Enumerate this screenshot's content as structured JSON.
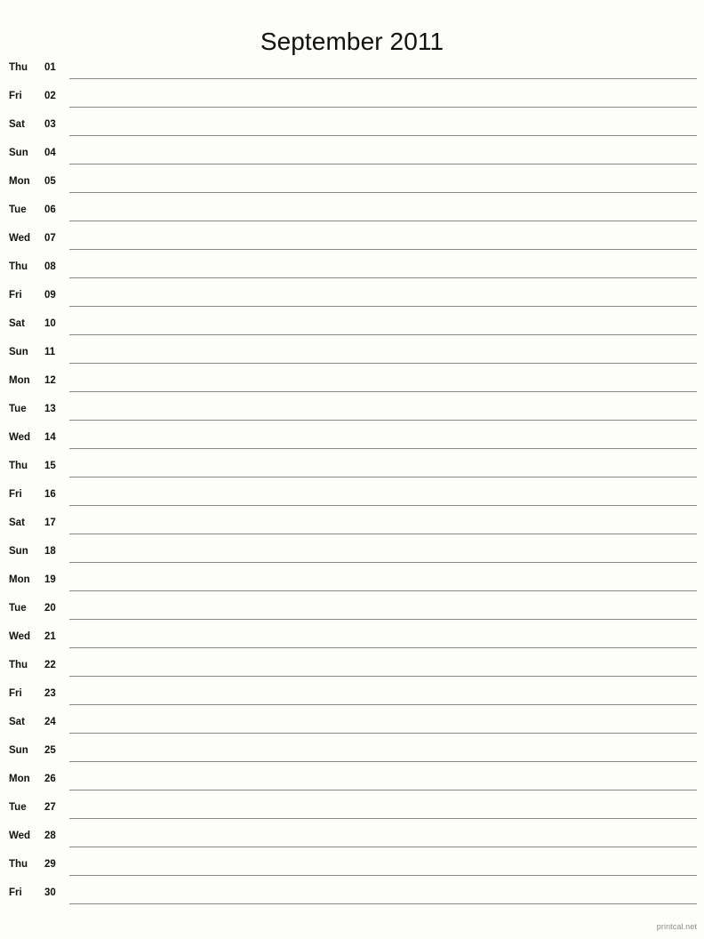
{
  "document": {
    "type": "printable-monthly-planner",
    "title": "September 2011",
    "month": "September",
    "year": "2011"
  },
  "colors": {
    "background": "#fdfdfa",
    "text": "#111111",
    "rule_line": "#8a8a8a",
    "footer_text": "#8c8c8c"
  },
  "days": [
    {
      "weekday": "Thu",
      "date": "01"
    },
    {
      "weekday": "Fri",
      "date": "02"
    },
    {
      "weekday": "Sat",
      "date": "03"
    },
    {
      "weekday": "Sun",
      "date": "04"
    },
    {
      "weekday": "Mon",
      "date": "05"
    },
    {
      "weekday": "Tue",
      "date": "06"
    },
    {
      "weekday": "Wed",
      "date": "07"
    },
    {
      "weekday": "Thu",
      "date": "08"
    },
    {
      "weekday": "Fri",
      "date": "09"
    },
    {
      "weekday": "Sat",
      "date": "10"
    },
    {
      "weekday": "Sun",
      "date": "11"
    },
    {
      "weekday": "Mon",
      "date": "12"
    },
    {
      "weekday": "Tue",
      "date": "13"
    },
    {
      "weekday": "Wed",
      "date": "14"
    },
    {
      "weekday": "Thu",
      "date": "15"
    },
    {
      "weekday": "Fri",
      "date": "16"
    },
    {
      "weekday": "Sat",
      "date": "17"
    },
    {
      "weekday": "Sun",
      "date": "18"
    },
    {
      "weekday": "Mon",
      "date": "19"
    },
    {
      "weekday": "Tue",
      "date": "20"
    },
    {
      "weekday": "Wed",
      "date": "21"
    },
    {
      "weekday": "Thu",
      "date": "22"
    },
    {
      "weekday": "Fri",
      "date": "23"
    },
    {
      "weekday": "Sat",
      "date": "24"
    },
    {
      "weekday": "Sun",
      "date": "25"
    },
    {
      "weekday": "Mon",
      "date": "26"
    },
    {
      "weekday": "Tue",
      "date": "27"
    },
    {
      "weekday": "Wed",
      "date": "28"
    },
    {
      "weekday": "Thu",
      "date": "29"
    },
    {
      "weekday": "Fri",
      "date": "30"
    }
  ],
  "footer": {
    "credit": "printcal.net"
  }
}
